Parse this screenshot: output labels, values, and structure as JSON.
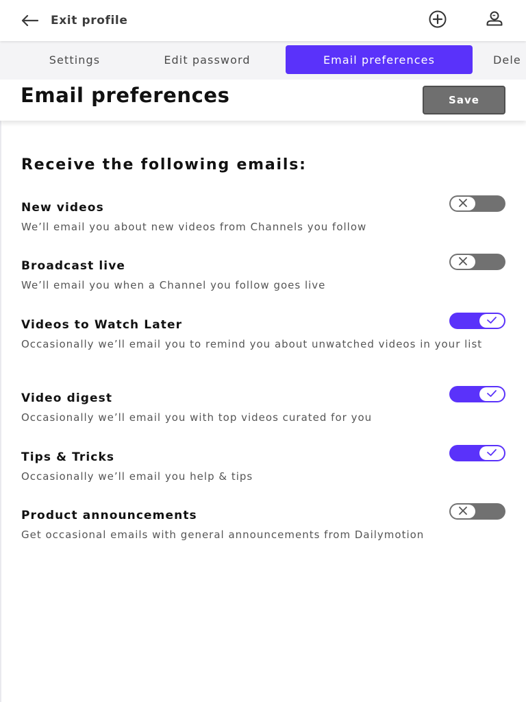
{
  "topbar": {
    "back_label": "Exit profile",
    "back_icon": "arrow-left-icon",
    "add_icon": "plus-circle-icon",
    "profile_icon": "user-icon"
  },
  "tabs": [
    {
      "label": "Settings",
      "active": false
    },
    {
      "label": "Edit password",
      "active": false
    },
    {
      "label": "Email preferences",
      "active": true
    },
    {
      "label": "Dele",
      "active": false
    }
  ],
  "header": {
    "title": "Email preferences",
    "save_label": "Save"
  },
  "section_title": "Receive the following emails:",
  "preferences": [
    {
      "title": "New videos",
      "description": "We’ll email you about new videos from Channels you follow",
      "enabled": false
    },
    {
      "title": "Broadcast live",
      "description": "We’ll email you when a Channel you follow goes live",
      "enabled": false
    },
    {
      "title": "Videos to Watch Later",
      "description": "Occasionally we’ll email you to remind you about unwatched videos in your list",
      "enabled": true
    },
    {
      "title": "Video digest",
      "description": "Occasionally we’ll email you with top videos curated for you",
      "enabled": true
    },
    {
      "title": "Tips & Tricks",
      "description": "Occasionally we’ll email you help & tips",
      "enabled": true
    },
    {
      "title": "Product announcements",
      "description": "Get occasional emails with general announcements from Dailymotion",
      "enabled": false
    }
  ],
  "colors": {
    "accent": "#5a32fa",
    "toggle_off": "#717171",
    "save_button": "#6f6f6f"
  }
}
